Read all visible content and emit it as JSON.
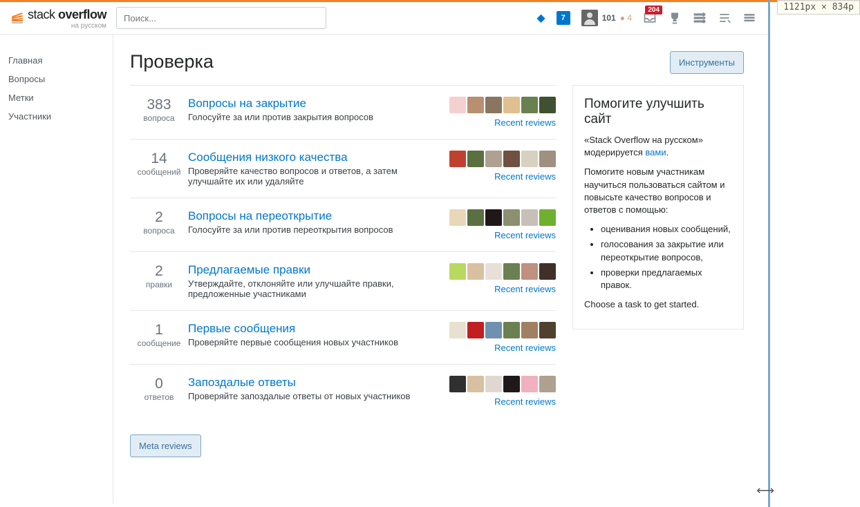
{
  "ruler": "1121px × 834p",
  "logo": {
    "text1": "stack",
    "text2": "overflow",
    "sub": "на русском"
  },
  "search": {
    "placeholder": "Поиск..."
  },
  "header": {
    "rep": "101",
    "bronze_count": "4",
    "badge_blue": "7",
    "badge_red": "204"
  },
  "nav": {
    "home": "Главная",
    "questions": "Вопросы",
    "tags": "Метки",
    "users": "Участники"
  },
  "page": {
    "title": "Проверка",
    "tools_btn": "Инструменты",
    "recent_reviews": "Recent reviews",
    "meta_reviews": "Meta reviews"
  },
  "queues": [
    {
      "count": "383",
      "unit": "вопроса",
      "title": "Вопросы на закрытие",
      "desc": "Голосуйте за или против закрытия вопросов"
    },
    {
      "count": "14",
      "unit": "сообщений",
      "title": "Сообщения низкого качества",
      "desc": "Проверяйте качество вопросов и ответов, а затем улучшайте их или удаляйте"
    },
    {
      "count": "2",
      "unit": "вопроса",
      "title": "Вопросы на переоткрытие",
      "desc": "Голосуйте за или против переоткрытия вопросов"
    },
    {
      "count": "2",
      "unit": "правки",
      "title": "Предлагаемые правки",
      "desc": "Утверждайте, отклоняйте или улучшайте правки, предложенные участниками"
    },
    {
      "count": "1",
      "unit": "сообщение",
      "title": "Первые сообщения",
      "desc": "Проверяйте первые сообщения новых участников"
    },
    {
      "count": "0",
      "unit": "ответов",
      "title": "Запоздалые ответы",
      "desc": "Проверяйте запоздалые ответы от новых участников"
    }
  ],
  "sidebar": {
    "title": "Помогите улучшить сайт",
    "line1_a": "«Stack Overflow на русском» модерируется ",
    "line1_link": "вами",
    "line1_b": ".",
    "line2": "Помогите новым участникам научиться пользоваться сайтом и повысьте качество вопросов и ответов с помощью:",
    "bullets": [
      "оценивания новых сообщений,",
      "голосования за закрытие или переоткрытие вопросов,",
      "проверки предлагаемых правок."
    ],
    "footer": "Choose a task to get started."
  },
  "avatar_colors": [
    [
      "#f5d0d0",
      "#b89070",
      "#8a7560",
      "#e0c090",
      "#6a8050",
      "#405030"
    ],
    [
      "#c04030",
      "#5a7040",
      "#b0a090",
      "#705040",
      "#d8d0c0",
      "#a09080"
    ],
    [
      "#e8d8b8",
      "#5a7040",
      "#201818",
      "#8a9070",
      "#c8c0b8",
      "#70b030"
    ],
    [
      "#b8d860",
      "#d8c0a0",
      "#e8e0d8",
      "#6a8050",
      "#c09080",
      "#403028"
    ],
    [
      "#e8e0d0",
      "#c02020",
      "#7090b0",
      "#6a8050",
      "#a08060",
      "#504030"
    ],
    [
      "#303030",
      "#d8c0a0",
      "#e0d8d0",
      "#201818",
      "#f0b0c0",
      "#b0a090"
    ]
  ]
}
